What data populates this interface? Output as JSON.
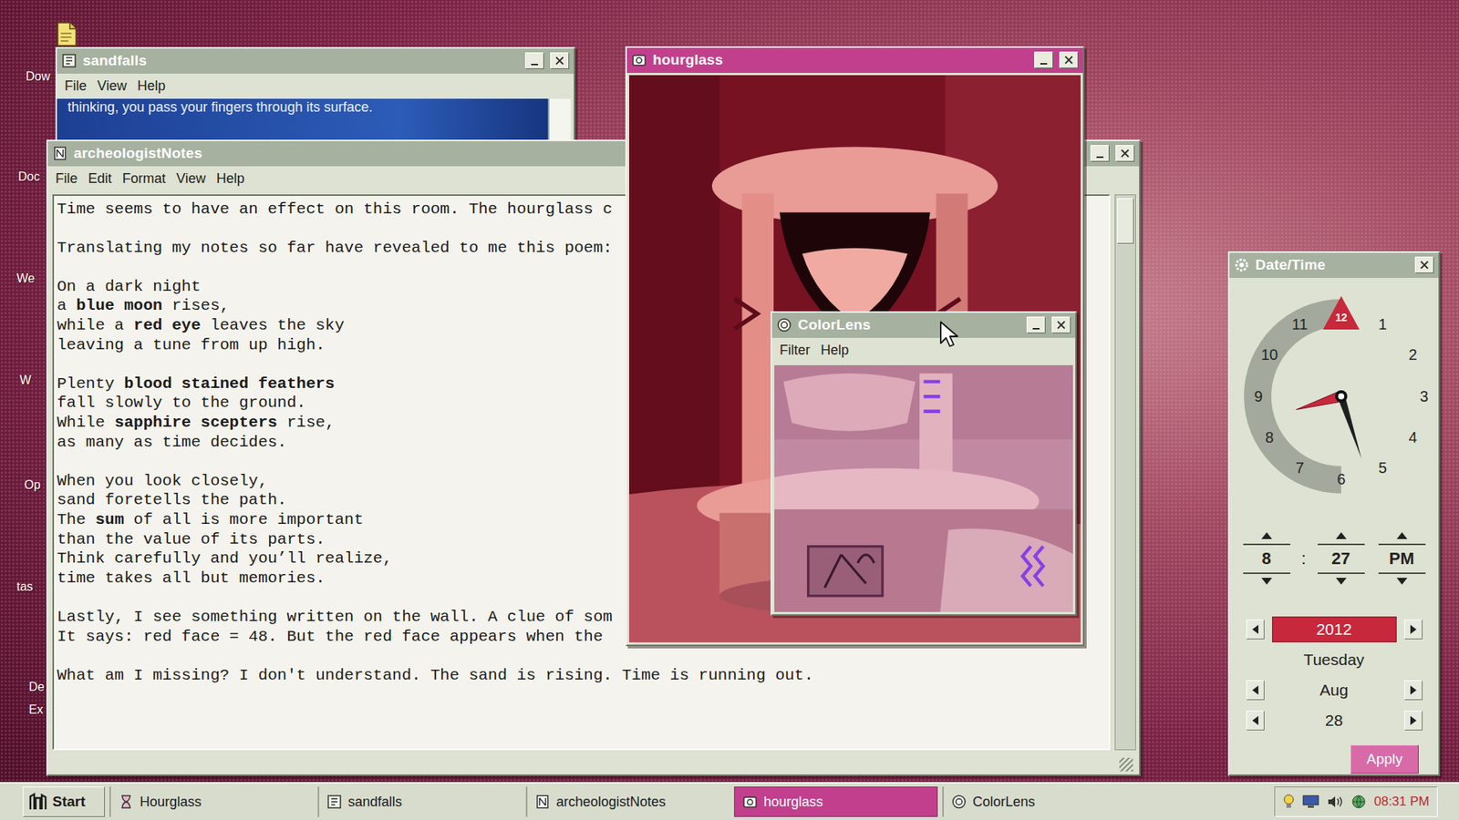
{
  "desktop": {
    "icons": [
      {
        "label": "Dow"
      },
      {
        "label": "Doc"
      },
      {
        "label": "We"
      },
      {
        "label": "W"
      },
      {
        "label": "Op"
      },
      {
        "label": "tas"
      },
      {
        "label": "De"
      },
      {
        "label": "Ex"
      }
    ]
  },
  "sandfalls": {
    "title": "sandfalls",
    "active": false,
    "menu": [
      "File",
      "View",
      "Help"
    ],
    "text": "thinking, you pass your fingers through its surface."
  },
  "notes": {
    "title": "archeologistNotes",
    "active": false,
    "menu": [
      "File",
      "Edit",
      "Format",
      "View",
      "Help"
    ],
    "lines": [
      [
        {
          "text": "Time seems to have an effect on this room. The hourglass c",
          "bold": false
        }
      ],
      [],
      [
        {
          "text": "Translating my notes so far have revealed to me this poem:",
          "bold": false
        }
      ],
      [],
      [
        {
          "text": "On a dark night",
          "bold": false
        }
      ],
      [
        {
          "text": "a ",
          "bold": false
        },
        {
          "text": "blue moon",
          "bold": true
        },
        {
          "text": " rises,",
          "bold": false
        }
      ],
      [
        {
          "text": "while a ",
          "bold": false
        },
        {
          "text": "red eye",
          "bold": true
        },
        {
          "text": " leaves the sky",
          "bold": false
        }
      ],
      [
        {
          "text": "leaving a tune from up high.",
          "bold": false
        }
      ],
      [],
      [
        {
          "text": "Plenty ",
          "bold": false
        },
        {
          "text": "blood stained feathers",
          "bold": true
        }
      ],
      [
        {
          "text": "fall slowly to the ground.",
          "bold": false
        }
      ],
      [
        {
          "text": "While ",
          "bold": false
        },
        {
          "text": "sapphire scepters",
          "bold": true
        },
        {
          "text": " rise,",
          "bold": false
        }
      ],
      [
        {
          "text": "as many as time decides.",
          "bold": false
        }
      ],
      [],
      [
        {
          "text": "When you look closely,",
          "bold": false
        }
      ],
      [
        {
          "text": "sand foretells the path.",
          "bold": false
        }
      ],
      [
        {
          "text": "The ",
          "bold": false
        },
        {
          "text": "sum",
          "bold": true
        },
        {
          "text": " of all is more important",
          "bold": false
        }
      ],
      [
        {
          "text": "than the value of its parts.",
          "bold": false
        }
      ],
      [
        {
          "text": "Think carefully and you’ll realize,",
          "bold": false
        }
      ],
      [
        {
          "text": "time takes all but memories.",
          "bold": false
        }
      ],
      [],
      [
        {
          "text": "Lastly, I see something written on the wall. A clue of som",
          "bold": false
        }
      ],
      [
        {
          "text": "It says: red face = 48. But the red face appears when the",
          "bold": false
        }
      ],
      [],
      [
        {
          "text": "What am I missing? I don't understand. The sand is rising. Time is running out.",
          "bold": false
        }
      ]
    ]
  },
  "hourglass": {
    "title": "hourglass",
    "active": true
  },
  "colorlens": {
    "title": "ColorLens",
    "active": false,
    "menu": [
      "Filter",
      "Help"
    ]
  },
  "datetime": {
    "title": "Date/Time",
    "active": false,
    "clock_numbers": [
      "12",
      "1",
      "2",
      "3",
      "4",
      "5",
      "6",
      "7",
      "8",
      "9",
      "10",
      "11"
    ],
    "hour": "8",
    "separator": ":",
    "minute": "27",
    "meridiem": "PM",
    "year": "2012",
    "weekday": "Tuesday",
    "month": "Aug",
    "day": "28",
    "apply": "Apply"
  },
  "taskbar": {
    "start": "Start",
    "items": [
      {
        "label": "Hourglass",
        "selected": false
      },
      {
        "label": "sandfalls",
        "selected": false
      },
      {
        "label": "archeologistNotes",
        "selected": false
      },
      {
        "label": "hourglass",
        "selected": true
      },
      {
        "label": "ColorLens",
        "selected": false
      }
    ],
    "clock": "08:31 PM"
  }
}
